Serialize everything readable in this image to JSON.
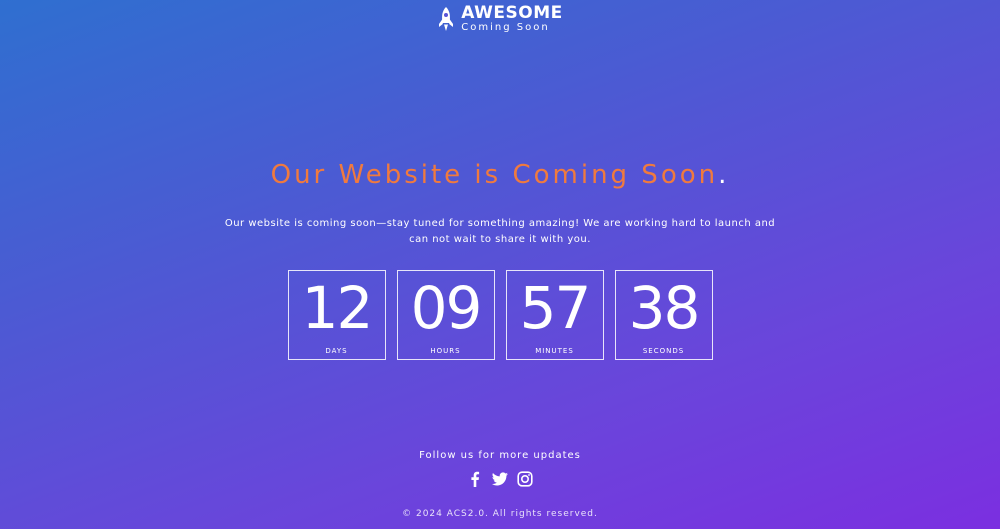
{
  "brand": {
    "icon": "rocket-icon",
    "title": "AWESOME",
    "subtitle": "Coming Soon"
  },
  "hero": {
    "headline": "Our Website is Coming Soon",
    "headline_dot": ".",
    "description_line1": "Our website is coming soon—stay tuned for something amazing! We are working hard to launch and",
    "description_line2": "can not wait to share it with you."
  },
  "countdown": [
    {
      "value": "12",
      "label": "DAYS"
    },
    {
      "value": "09",
      "label": "HOURS"
    },
    {
      "value": "57",
      "label": "MINUTES"
    },
    {
      "value": "38",
      "label": "SECONDS"
    }
  ],
  "footer": {
    "follow_text": "Follow us for more updates",
    "social": [
      "facebook-icon",
      "twitter-icon",
      "instagram-icon"
    ],
    "copyright": "© 2024 ACS2.0. All rights reserved."
  },
  "colors": {
    "accent": "#f07a3e",
    "gradient_start": "#2f6fd0",
    "gradient_end": "#7b2fe0"
  }
}
